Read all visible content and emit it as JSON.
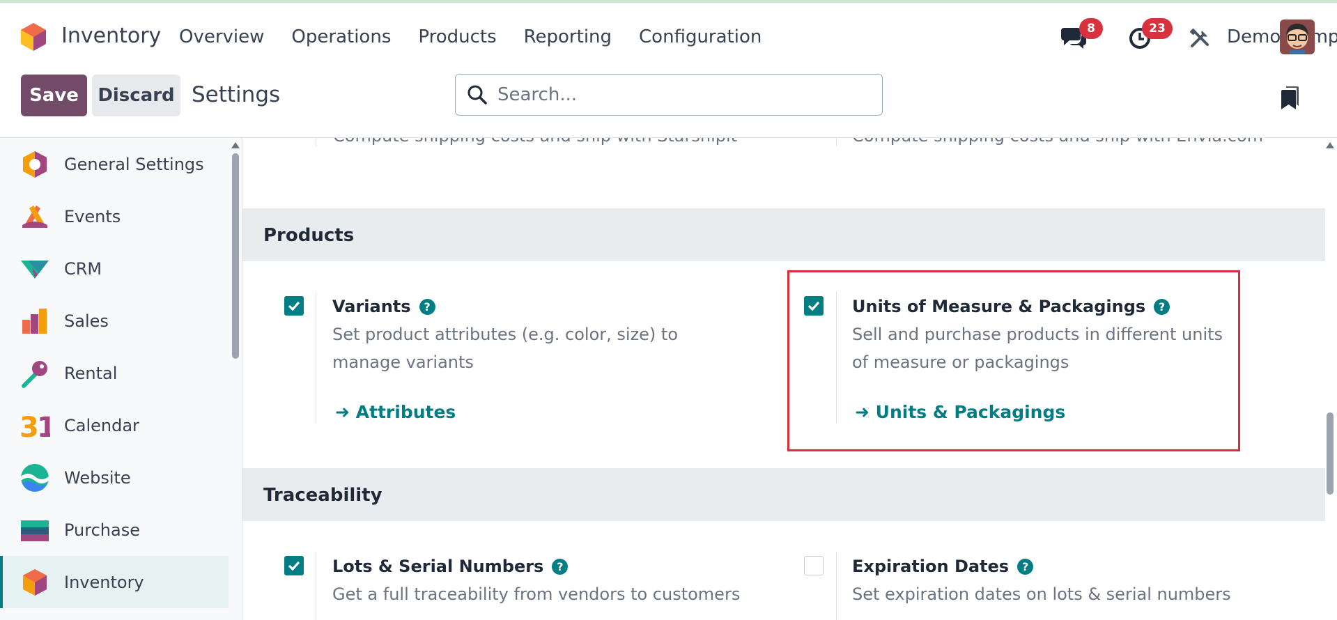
{
  "topbar": {
    "app_title": "Inventory",
    "menu": [
      "Overview",
      "Operations",
      "Products",
      "Reporting",
      "Configuration"
    ],
    "messages_count": "8",
    "activities_count": "23",
    "company": "Demo Company"
  },
  "control": {
    "save_label": "Save",
    "discard_label": "Discard",
    "title": "Settings",
    "search_placeholder": "Search..."
  },
  "sidebar": {
    "items": [
      {
        "label": "General Settings",
        "icon": "general-settings-icon"
      },
      {
        "label": "Events",
        "icon": "events-icon"
      },
      {
        "label": "CRM",
        "icon": "crm-icon"
      },
      {
        "label": "Sales",
        "icon": "sales-icon"
      },
      {
        "label": "Rental",
        "icon": "rental-icon"
      },
      {
        "label": "Calendar",
        "icon": "calendar-icon"
      },
      {
        "label": "Website",
        "icon": "website-icon"
      },
      {
        "label": "Purchase",
        "icon": "purchase-icon"
      },
      {
        "label": "Inventory",
        "icon": "inventory-icon"
      }
    ],
    "active": "Inventory"
  },
  "main": {
    "cut_left": "Compute shipping costs and ship with Starshipit",
    "cut_right": "Compute shipping costs and ship with Envia.com",
    "products": {
      "title": "Products",
      "variants": {
        "title": "Variants",
        "desc": "Set product attributes (e.g. color, size) to manage variants",
        "link": "Attributes",
        "checked": true
      },
      "uom": {
        "title": "Units of Measure & Packagings",
        "desc": "Sell and purchase products in different units of measure or packagings",
        "link": "Units & Packagings",
        "checked": true
      }
    },
    "traceability": {
      "title": "Traceability",
      "lots": {
        "title": "Lots & Serial Numbers",
        "desc": "Get a full traceability from vendors to customers",
        "checked": true
      },
      "expiration": {
        "title": "Expiration Dates",
        "desc": "Set expiration dates on lots & serial numbers",
        "checked": false
      }
    }
  },
  "colors": {
    "brand_purple": "#714b67",
    "teal": "#017e84",
    "badge_red": "#d9323f",
    "highlight_red": "#d62d3a"
  }
}
